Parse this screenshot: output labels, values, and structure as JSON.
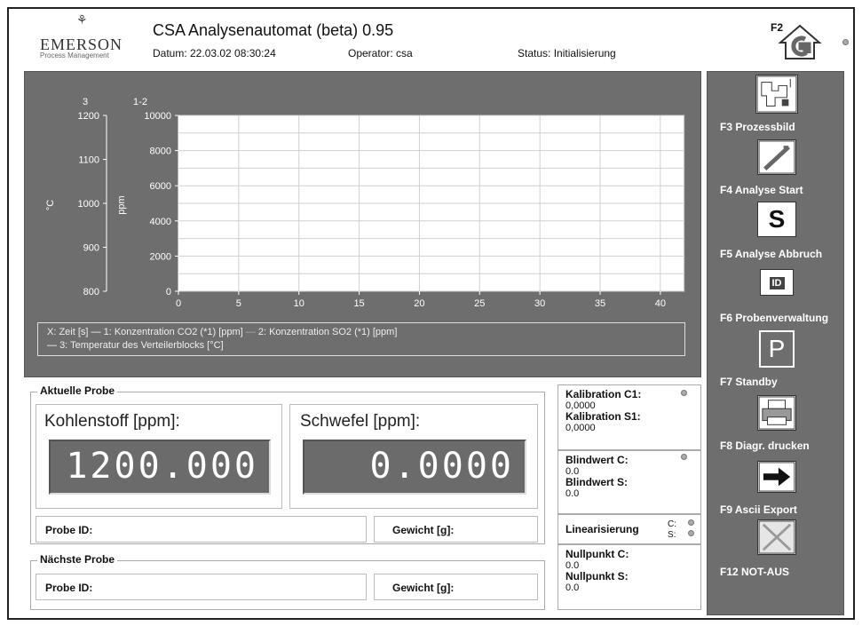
{
  "header": {
    "logo": "EMERSON",
    "logo_sub": "Process Management",
    "title": "CSA Analysenautomat (beta) 0.95",
    "date": "Datum: 22.03.02 08:30:24",
    "operator": "Operator: csa",
    "status": "Status: Initialisierung",
    "f2_label": "F2"
  },
  "chart_data": {
    "type": "line",
    "x": [
      0,
      5,
      10,
      15,
      20,
      25,
      30,
      35,
      40
    ],
    "xlim": [
      0,
      42
    ],
    "axes": [
      {
        "id": "3",
        "label": "°C",
        "ticks": [
          800,
          900,
          1000,
          1100,
          1200
        ],
        "ylim": [
          800,
          1200
        ]
      },
      {
        "id": "1-2",
        "label": "ppm",
        "ticks": [
          0,
          2000,
          4000,
          6000,
          8000,
          10000
        ],
        "ylim": [
          0,
          10000
        ]
      }
    ],
    "series": [],
    "legend": [
      "X: Zeit [s]",
      "1: Konzentration CO2 (*1) [ppm]",
      "2: Konzentration SO2 (*1) [ppm]",
      "3: Temperatur des Verteilerblocks [°C]"
    ],
    "grid": true,
    "colors": {
      "panel": "#6e6e6e",
      "plot": "#ffffff",
      "grid": "#d0d0d0"
    }
  },
  "current": {
    "title": "Aktuelle Probe",
    "carbon_label": "Kohlenstoff [ppm]:",
    "carbon_value": "1200.000",
    "sulfur_label": "Schwefel [ppm]:",
    "sulfur_value": "0.0000",
    "probe_id": "Probe ID:",
    "weight": "Gewicht [g]:"
  },
  "next": {
    "title": "Nächste Probe",
    "probe_id": "Probe ID:",
    "weight": "Gewicht [g]:"
  },
  "info": {
    "cal_c1_label": "Kalibration C1:",
    "cal_c1_value": "0,0000",
    "cal_s1_label": "Kalibration S1:",
    "cal_s1_value": "0,0000",
    "blank_c_label": "Blindwert C:",
    "blank_c_value": "0.0",
    "blank_s_label": "Blindwert S:",
    "blank_s_value": "0.0",
    "lin_label": "Linearisierung",
    "lin_c": "C:",
    "lin_s": "S:",
    "zero_c_label": "Nullpunkt C:",
    "zero_c_value": "0.0",
    "zero_s_label": "Nullpunkt S:",
    "zero_s_value": "0.0"
  },
  "sidebar": {
    "items": [
      {
        "label": "F3 Prozessbild",
        "icon": "process-diagram-icon"
      },
      {
        "label": "F4 Analyse Start",
        "icon": "analysis-start-icon"
      },
      {
        "label": "F5 Analyse Abbruch",
        "icon": "stop-s-icon"
      },
      {
        "label": "F6 Probenverwaltung",
        "icon": "id-card-icon"
      },
      {
        "label": "F7 Standby",
        "icon": "parking-p-icon"
      },
      {
        "label": "F8 Diagr. drucken",
        "icon": "printer-icon"
      },
      {
        "label": "F9 Ascii Export",
        "icon": "export-arrow-icon"
      },
      {
        "label": "F12 NOT-AUS",
        "icon": "emergency-x-icon"
      }
    ],
    "icon_texts": {
      "stop": "S",
      "id": "ID",
      "standby": "P"
    }
  }
}
